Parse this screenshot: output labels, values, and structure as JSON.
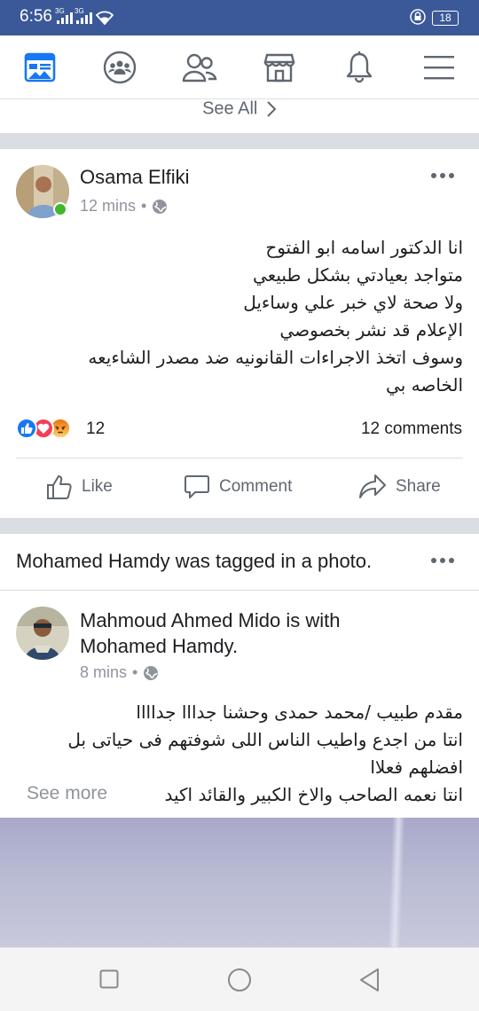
{
  "status_bar": {
    "time": "6:56",
    "sim1_label": "3G",
    "sim2_label": "3G",
    "battery": "18"
  },
  "nav": {
    "icons": [
      "news-feed-icon",
      "groups-icon",
      "friends-icon",
      "marketplace-icon",
      "notifications-icon",
      "menu-icon"
    ],
    "active_color": "#1877f2"
  },
  "see_all": "See All",
  "post1": {
    "author": "Osama Elfiki",
    "time": "12 mins",
    "lines": [
      "انا الدكتور اسامه ابو الفتوح",
      "متواجد بعيادتي بشكل طبيعي",
      "ولا صحة لاي خبر علي وساءيل",
      "الإعلام  قد نشر بخصوصي",
      "وسوف اتخذ الاجراءات القانونيه ضد مصدر الشاءيعه",
      "الخاصه بي"
    ],
    "reaction_count": "12",
    "comments": "12 comments",
    "actions": {
      "like": "Like",
      "comment": "Comment",
      "share": "Share"
    }
  },
  "post2": {
    "tag_name": "Mohamed Hamdy",
    "tag_text": " was tagged in a photo.",
    "author": "Mahmoud Ahmed Mido",
    "with_text": " is with",
    "with_name": "Mohamed Hamdy",
    "with_end": ".",
    "time": "8 mins",
    "lines": [
      "مقدم طبيب /محمد حمدى وحشنا جدااا جداااا",
      "انتا من اجدع واطيب الناس اللى شوفتهم فى حياتى بل",
      "افضلهم فعلاا",
      "انتا نعمه الصاحب والاخ الكبير والقائد اكيد و..."
    ],
    "see_more": "See more"
  },
  "colors": {
    "facebook_blue": "#3b5998",
    "like_blue": "#1877f2",
    "love_red": "#f33e58",
    "angry_orange": "#e9710f",
    "online_green": "#42b72a"
  }
}
